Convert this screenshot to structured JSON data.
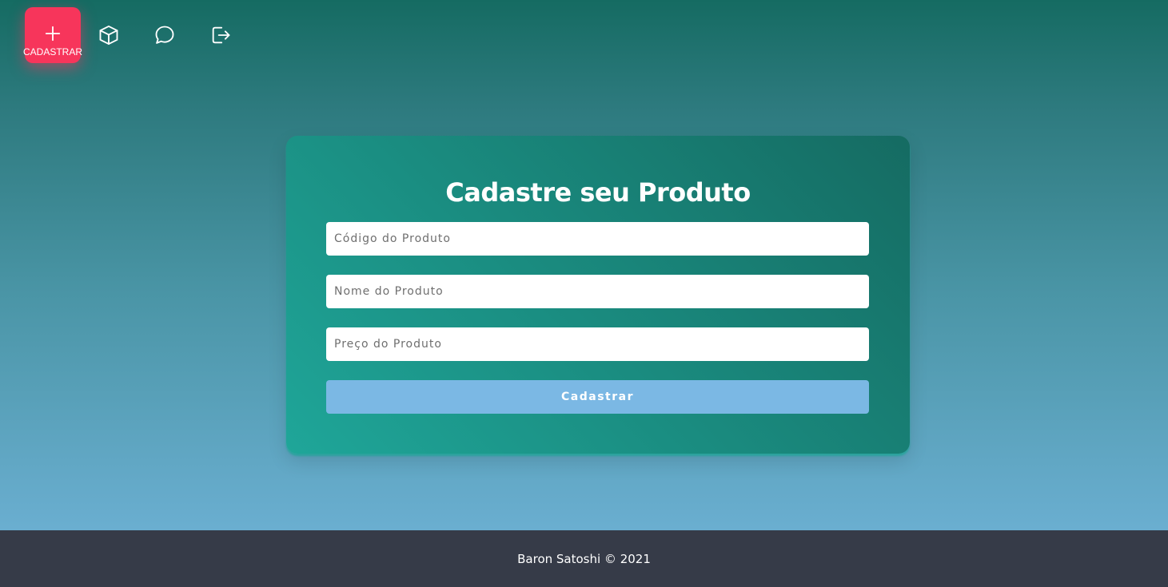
{
  "nav": {
    "items": [
      {
        "icon": "plus-icon",
        "label": "CADASTRAR",
        "active": true
      },
      {
        "icon": "box-icon"
      },
      {
        "icon": "chat-icon"
      },
      {
        "icon": "logout-icon"
      }
    ]
  },
  "form": {
    "title": "Cadastre seu Produto",
    "fields": [
      {
        "placeholder": "Código do Produto",
        "value": ""
      },
      {
        "placeholder": "Nome do Produto",
        "value": ""
      },
      {
        "placeholder": "Preço do Produto",
        "value": ""
      }
    ],
    "submit_label": "Cadastrar"
  },
  "footer": {
    "text": "Baron Satoshi © 2021"
  },
  "colors": {
    "accent": "#f7355b",
    "card": "#1a8c80",
    "button": "#7bb8e4",
    "footer": "#363b48"
  }
}
